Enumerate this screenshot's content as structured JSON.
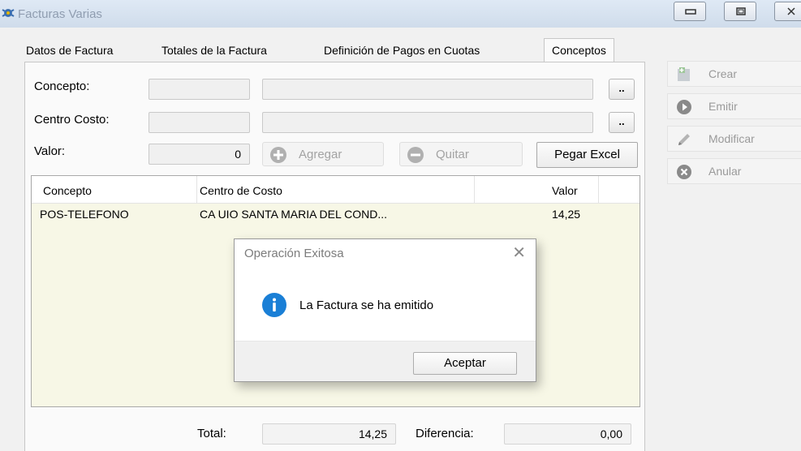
{
  "window": {
    "title": "Facturas Varias",
    "icon": "app-icon"
  },
  "tabs": [
    {
      "label": "Datos de Factura"
    },
    {
      "label": "Totales de la Factura"
    },
    {
      "label": "Definición de Pagos en Cuotas"
    },
    {
      "label": "Conceptos",
      "active": true
    }
  ],
  "form": {
    "concepto_label": "Concepto:",
    "centro_label": "Centro Costo:",
    "valor_label": "Valor:",
    "valor_value": "0",
    "browse_label": "..",
    "agregar_label": "Agregar",
    "quitar_label": "Quitar",
    "pegar_label": "Pegar Excel"
  },
  "grid": {
    "columns": [
      "Concepto",
      "Centro de Costo",
      "Valor"
    ],
    "rows": [
      {
        "concepto": "POS-TELEFONO",
        "centro": "CA UIO SANTA MARIA DEL COND...",
        "valor": "14,25"
      }
    ]
  },
  "totals": {
    "total_label": "Total:",
    "total_value": "14,25",
    "diferencia_label": "Diferencia:",
    "diferencia_value": "0,00"
  },
  "actions": [
    {
      "label": "Crear",
      "icon": "new-document-icon"
    },
    {
      "label": "Emitir",
      "icon": "play-icon"
    },
    {
      "label": "Modificar",
      "icon": "pencil-icon"
    },
    {
      "label": "Anular",
      "icon": "cancel-icon"
    }
  ],
  "dialog": {
    "title": "Operación Exitosa",
    "close_glyph": "✕",
    "message": "La Factura se ha emitido",
    "ok_label": "Aceptar",
    "icon": "info-icon"
  },
  "colors": {
    "info_blue": "#1a7fd6",
    "grid_bg": "#f7f7e6"
  }
}
